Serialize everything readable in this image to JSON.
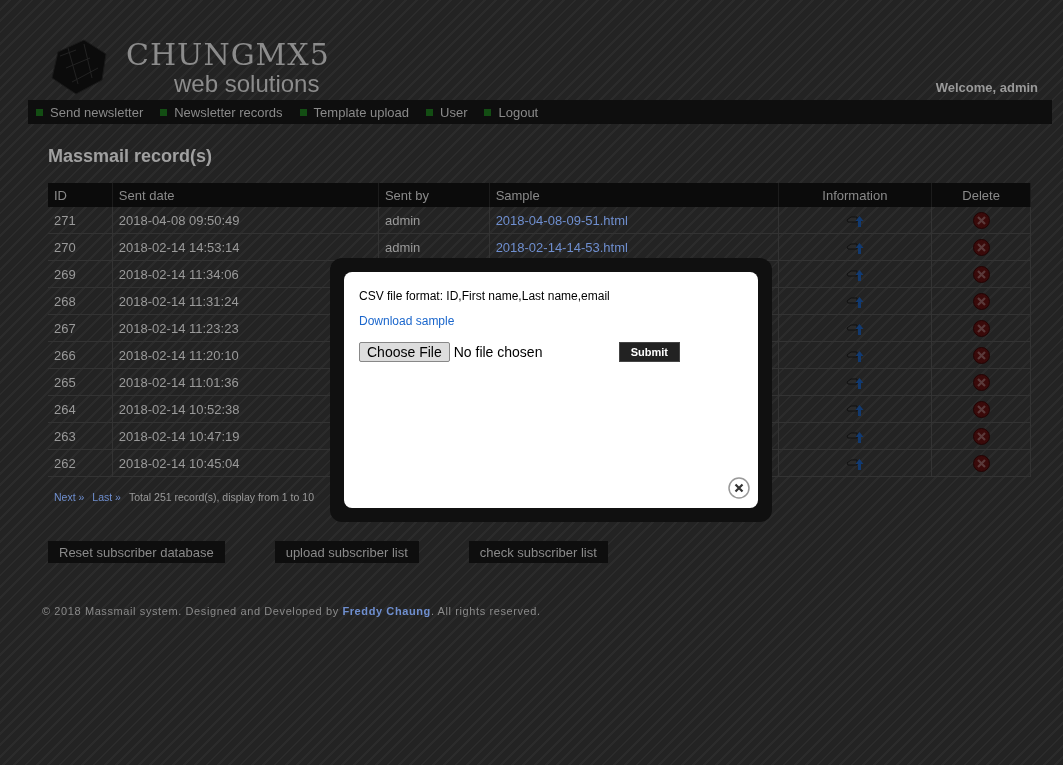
{
  "logo": {
    "wordmark": "CHUNGMX5",
    "tagline": "web solutions"
  },
  "welcome": "Welcome, admin",
  "nav": [
    {
      "label": "Send newsletter"
    },
    {
      "label": "Newsletter records"
    },
    {
      "label": "Template upload"
    },
    {
      "label": "User"
    },
    {
      "label": "Logout"
    }
  ],
  "page_title": "Massmail record(s)",
  "table": {
    "columns": [
      "ID",
      "Sent date",
      "Sent by",
      "Sample",
      "Information",
      "Delete"
    ],
    "rows": [
      {
        "id": "271",
        "sent_date": "2018-04-08 09:50:49",
        "sent_by": "admin",
        "sample": "2018-04-08-09-51.html"
      },
      {
        "id": "270",
        "sent_date": "2018-02-14 14:53:14",
        "sent_by": "admin",
        "sample": "2018-02-14-14-53.html"
      },
      {
        "id": "269",
        "sent_date": "2018-02-14 11:34:06"
      },
      {
        "id": "268",
        "sent_date": "2018-02-14 11:31:24"
      },
      {
        "id": "267",
        "sent_date": "2018-02-14 11:23:23"
      },
      {
        "id": "266",
        "sent_date": "2018-02-14 11:20:10"
      },
      {
        "id": "265",
        "sent_date": "2018-02-14 11:01:36"
      },
      {
        "id": "264",
        "sent_date": "2018-02-14 10:52:38"
      },
      {
        "id": "263",
        "sent_date": "2018-02-14 10:47:19"
      },
      {
        "id": "262",
        "sent_date": "2018-02-14 10:45:04"
      }
    ]
  },
  "pager": {
    "links": [
      "Next »",
      "Last »"
    ],
    "summary": "Total 251 record(s), display from 1 to 10"
  },
  "actions": [
    "Reset subscriber database",
    "upload subscriber list",
    "check subscriber list"
  ],
  "footer": {
    "before": "© 2018 Massmail system. Designed and Developed by ",
    "link": "Freddy Chaung",
    "after": ". All rights reserved."
  },
  "modal": {
    "format_text": "CSV file format: ID,First name,Last name,email",
    "download_link": "Download sample",
    "choose_button": "Choose File",
    "file_status": "No file chosen",
    "submit": "Submit"
  }
}
